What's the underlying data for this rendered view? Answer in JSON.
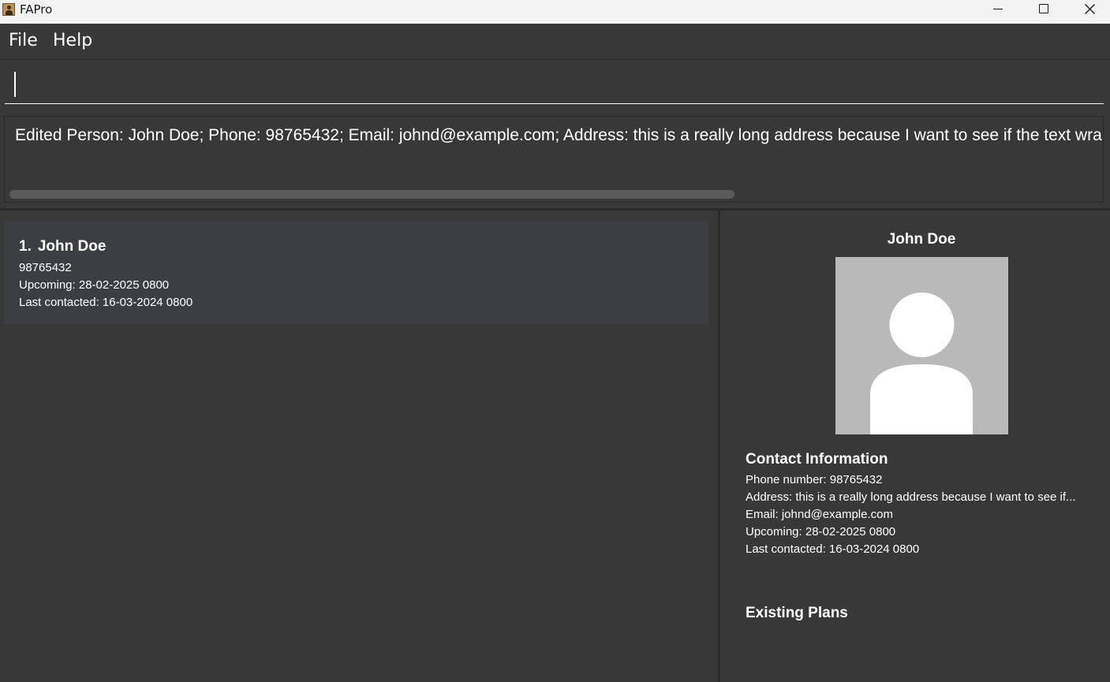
{
  "window": {
    "title": "FAPro"
  },
  "menu": {
    "file": "File",
    "help": "Help"
  },
  "command": {
    "value": ""
  },
  "result": {
    "text": "Edited Person: John Doe; Phone: 98765432; Email: johnd@example.com; Address: this is a really long address because I want to see if the text wraps arou"
  },
  "person_list": [
    {
      "index": "1.",
      "name": "John Doe",
      "phone": "98765432",
      "upcoming": "Upcoming: 28-02-2025 0800",
      "last_contacted": "Last contacted: 16-03-2024 0800"
    }
  ],
  "detail": {
    "name": "John Doe",
    "contact_title": "Contact Information",
    "phone": "Phone number: 98765432",
    "address": "Address: this is a really long address because I want to see if...",
    "email": "Email: johnd@example.com",
    "upcoming": "Upcoming: 28-02-2025 0800",
    "last_contacted": "Last contacted: 16-03-2024 0800",
    "plans_title": "Existing Plans"
  },
  "colors": {
    "background": "#383838",
    "card": "#3c3e42",
    "separator": "#2a2a2a",
    "titlebar": "#f3f3f3",
    "avatar_bg": "#b9b9b9"
  }
}
